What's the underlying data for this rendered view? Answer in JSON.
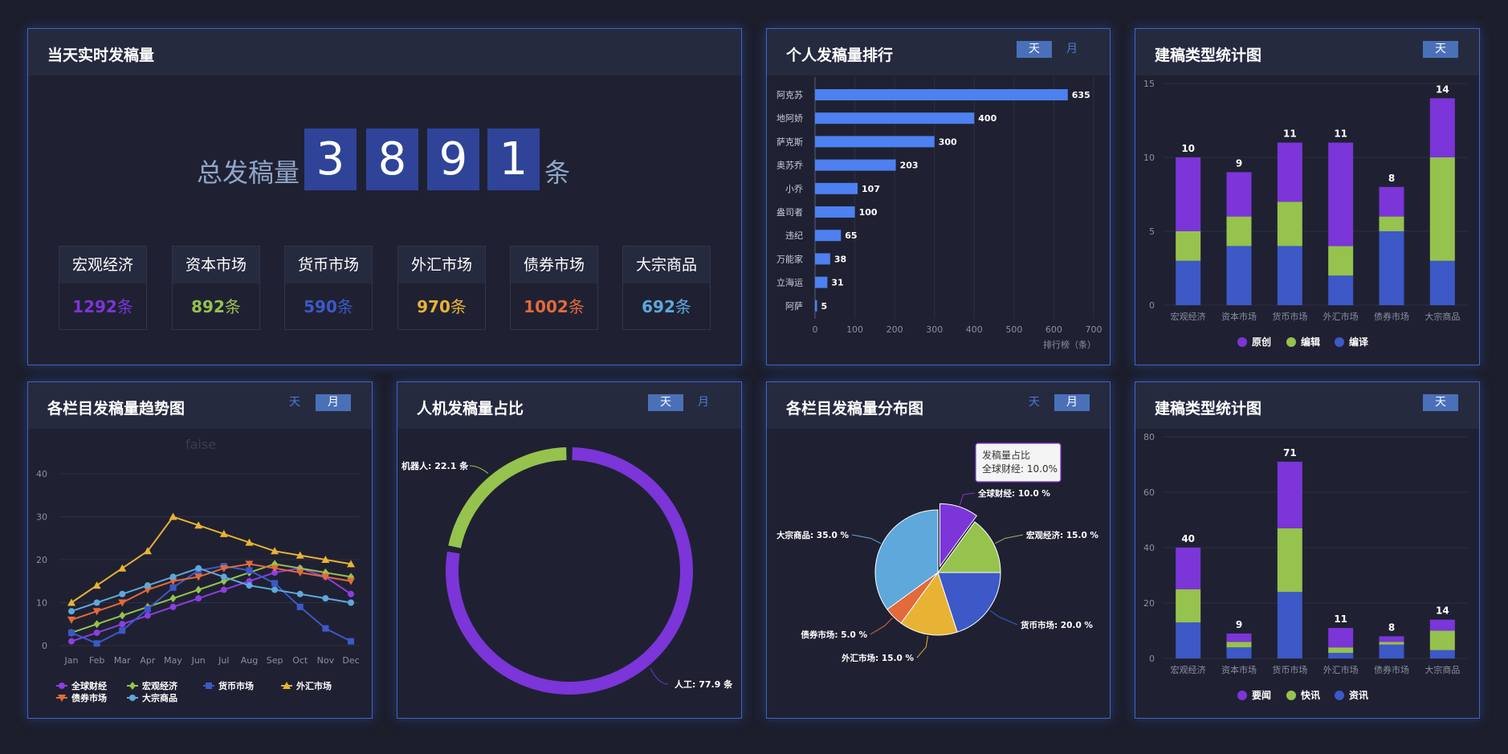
{
  "realtime": {
    "title": "当天实时发稿量",
    "total_label": "总发稿量",
    "digits": [
      "3",
      "8",
      "9",
      "1"
    ],
    "unit": "条",
    "categories": [
      {
        "name": "宏观经济",
        "value": "1292",
        "color": "#7b35d8"
      },
      {
        "name": "资本市场",
        "value": "892",
        "color": "#96c24e"
      },
      {
        "name": "货币市场",
        "value": "590",
        "color": "#3d58c7"
      },
      {
        "name": "外汇市场",
        "value": "970",
        "color": "#e8b234"
      },
      {
        "name": "债券市场",
        "value": "1002",
        "color": "#e26a3b"
      },
      {
        "name": "大宗商品",
        "value": "692",
        "color": "#5ea8dc"
      }
    ]
  },
  "ranking": {
    "title": "个人发稿量排行",
    "toggles": [
      "天",
      "月"
    ],
    "chart_data": {
      "type": "bar",
      "orientation": "horizontal",
      "categories": [
        "阿克苏",
        "地阿娇",
        "萨克斯",
        "奥苏乔",
        "小乔",
        "盎司者",
        "违纪",
        "万能家",
        "立海运",
        "阿萨"
      ],
      "values": [
        635,
        400,
        300,
        203,
        107,
        100,
        65,
        38,
        31,
        5
      ],
      "xlim": [
        0,
        700
      ],
      "xticks": [
        0,
        100,
        200,
        300,
        400,
        500,
        600,
        700
      ],
      "xlabel": "排行榜（条）",
      "color": "#4d80f0",
      "grid": true
    }
  },
  "type_stats_1": {
    "title": "建稿类型统计图",
    "toggles": [
      "天"
    ],
    "chart_data": {
      "type": "bar",
      "stacked": true,
      "categories": [
        "宏观经济",
        "资本市场",
        "货币市场",
        "外汇市场",
        "债券市场",
        "大宗商品"
      ],
      "series": [
        {
          "name": "编译",
          "values": [
            3,
            4,
            4,
            2,
            5,
            3
          ],
          "color": "#3d58c7"
        },
        {
          "name": "编辑",
          "values": [
            2,
            2,
            3,
            2,
            1,
            7
          ],
          "color": "#96c24e"
        },
        {
          "name": "原创",
          "values": [
            5,
            3,
            4,
            7,
            2,
            4
          ],
          "color": "#7b35d8"
        }
      ],
      "totals": [
        10,
        9,
        11,
        11,
        8,
        14
      ],
      "ylim": [
        0,
        15
      ],
      "yticks": [
        0,
        5,
        10,
        15
      ],
      "legend": [
        "原创",
        "编辑",
        "编译"
      ],
      "legend_position": "bottom"
    }
  },
  "trend": {
    "title": "各栏目发稿量趋势图",
    "toggles": [
      "天",
      "月"
    ],
    "chart_data": {
      "type": "line",
      "subtitle": "false",
      "x": [
        "Jan",
        "Feb",
        "Mar",
        "Apr",
        "May",
        "Jun",
        "Jul",
        "Aug",
        "Sep",
        "Oct",
        "Nov",
        "Dec"
      ],
      "ylim": [
        0,
        40
      ],
      "yticks": [
        0,
        10,
        20,
        30,
        40
      ],
      "series": [
        {
          "name": "全球财经",
          "values": [
            1,
            3,
            5,
            7,
            9,
            11,
            13,
            15,
            17,
            18,
            16,
            12
          ],
          "color": "#8a3fe0",
          "marker": "circle"
        },
        {
          "name": "宏观经济",
          "values": [
            3,
            5,
            7,
            9,
            11,
            13,
            15,
            17,
            19,
            18,
            17,
            16
          ],
          "color": "#96c24e",
          "marker": "diamond"
        },
        {
          "name": "货币市场",
          "values": [
            3,
            0.5,
            3.5,
            8.5,
            13.5,
            17.5,
            18.5,
            17.5,
            14.5,
            9,
            4,
            1
          ],
          "color": "#3d58c7",
          "marker": "square"
        },
        {
          "name": "外汇市场",
          "values": [
            10,
            14,
            18,
            22,
            30,
            28,
            26,
            24,
            22,
            21,
            20,
            19
          ],
          "color": "#e8b234",
          "marker": "triangle"
        },
        {
          "name": "债券市场",
          "values": [
            6,
            8,
            10,
            13,
            15,
            16,
            18,
            19,
            18,
            17,
            16,
            15
          ],
          "color": "#e26a3b",
          "marker": "triangle-down"
        },
        {
          "name": "大宗商品",
          "values": [
            8,
            10,
            12,
            14,
            16,
            18,
            16,
            14,
            13,
            12,
            11,
            10
          ],
          "color": "#5ea8dc",
          "marker": "circle"
        }
      ],
      "legend_position": "bottom"
    }
  },
  "human_machine": {
    "title": "人机发稿量占比",
    "toggles": [
      "天",
      "月"
    ],
    "chart_data": {
      "type": "pie",
      "donut": true,
      "slices": [
        {
          "name": "人工",
          "value": 77.9,
          "color": "#7b35d8",
          "label": "人工: 77.9 条"
        },
        {
          "name": "机器人",
          "value": 22.1,
          "color": "#96c24e",
          "label": "机器人: 22.1 条"
        }
      ]
    }
  },
  "distribution": {
    "title": "各栏目发稿量分布图",
    "toggles": [
      "天",
      "月"
    ],
    "tooltip": {
      "line1": "发稿量占比",
      "line2": "全球财经: 10.0%"
    },
    "chart_data": {
      "type": "pie",
      "slices": [
        {
          "name": "全球财经",
          "value": 10.0,
          "color": "#7b35d8",
          "label": "全球财经: 10.0 %"
        },
        {
          "name": "宏观经济",
          "value": 15.0,
          "color": "#96c24e",
          "label": "宏观经济: 15.0 %"
        },
        {
          "name": "货币市场",
          "value": 20.0,
          "color": "#3d58c7",
          "label": "货币市场: 20.0 %"
        },
        {
          "name": "外汇市场",
          "value": 15.0,
          "color": "#e8b234",
          "label": "外汇市场: 15.0 %"
        },
        {
          "name": "债券市场",
          "value": 5.0,
          "color": "#e26a3b",
          "label": "债券市场: 5.0 %"
        },
        {
          "name": "大宗商品",
          "value": 35.0,
          "color": "#5ea8dc",
          "label": "大宗商品: 35.0 %"
        }
      ]
    }
  },
  "type_stats_2": {
    "title": "建稿类型统计图",
    "toggles": [
      "天"
    ],
    "chart_data": {
      "type": "bar",
      "stacked": true,
      "categories": [
        "宏观经济",
        "资本市场",
        "货币市场",
        "外汇市场",
        "债券市场",
        "大宗商品"
      ],
      "series": [
        {
          "name": "资讯",
          "values": [
            13,
            4,
            24,
            2,
            5,
            3
          ],
          "color": "#3d58c7"
        },
        {
          "name": "快讯",
          "values": [
            12,
            2,
            23,
            2,
            1,
            7
          ],
          "color": "#96c24e"
        },
        {
          "name": "要闻",
          "values": [
            15,
            3,
            24,
            7,
            2,
            4
          ],
          "color": "#7b35d8"
        }
      ],
      "totals": [
        40,
        9,
        71,
        11,
        8,
        14
      ],
      "ylim": [
        0,
        80
      ],
      "yticks": [
        0,
        20,
        40,
        60,
        80
      ],
      "legend": [
        "要闻",
        "快讯",
        "资讯"
      ],
      "legend_position": "bottom"
    }
  }
}
